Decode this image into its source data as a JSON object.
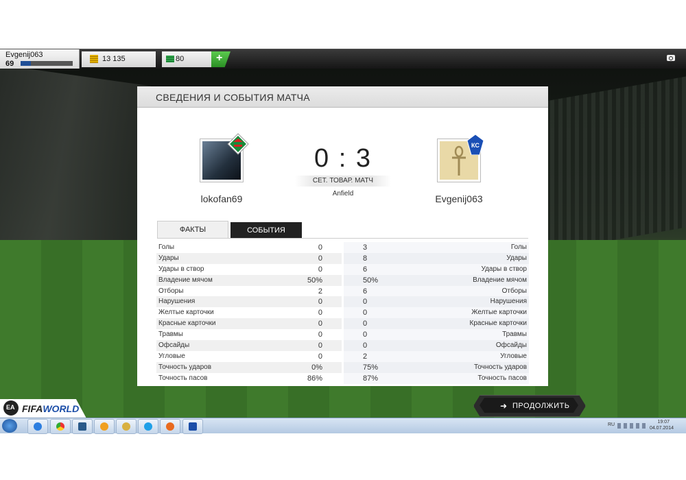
{
  "topbar": {
    "player_name": "Evgenij063",
    "player_level": "69",
    "level_progress": 0.2,
    "coins": "13 135",
    "points": "80",
    "add_points_label": "+"
  },
  "panel": {
    "title": "СВЕДЕНИЯ И СОБЫТИЯ МАТЧА",
    "home_team": "lokofan69",
    "away_team": "Evgenij063",
    "score": "0 : 3",
    "match_type": "СЕТ. ТОВАР. МАТЧ",
    "venue": "Anfield",
    "tabs": [
      {
        "label": "ФАКТЫ",
        "active": true
      },
      {
        "label": "СОБЫТИЯ",
        "active": false
      }
    ],
    "stats": [
      {
        "label": "Голы",
        "home": "0",
        "away": "3"
      },
      {
        "label": "Удары",
        "home": "0",
        "away": "8"
      },
      {
        "label": "Удары в створ",
        "home": "0",
        "away": "6"
      },
      {
        "label": "Владение мячом",
        "home": "50%",
        "away": "50%"
      },
      {
        "label": "Отборы",
        "home": "2",
        "away": "6"
      },
      {
        "label": "Нарушения",
        "home": "0",
        "away": "0"
      },
      {
        "label": "Желтые карточки",
        "home": "0",
        "away": "0"
      },
      {
        "label": "Красные карточки",
        "home": "0",
        "away": "0"
      },
      {
        "label": "Травмы",
        "home": "0",
        "away": "0"
      },
      {
        "label": "Офсайды",
        "home": "0",
        "away": "0"
      },
      {
        "label": "Угловые",
        "home": "0",
        "away": "2"
      },
      {
        "label": "Точность ударов",
        "home": "0%",
        "away": "75%"
      },
      {
        "label": "Точность пасов",
        "home": "86%",
        "away": "87%"
      }
    ]
  },
  "bottom": {
    "continue_label": "ПРОДОЛЖИТЬ",
    "logo_ea": "EA",
    "logo_fifa": "FIFA",
    "logo_world": "WORLD"
  },
  "taskbar": {
    "lang": "RU",
    "time": "19:07",
    "date": "04.07.2014",
    "apps": [
      "ie-icon",
      "chrome-icon",
      "media-icon",
      "player-icon",
      "paint-icon",
      "skype-icon",
      "firefox-icon",
      "fifa-world-icon"
    ]
  },
  "colors": {
    "accent_blue": "#1f4e96",
    "add_green": "#3db035",
    "dark_tab": "#222222"
  }
}
